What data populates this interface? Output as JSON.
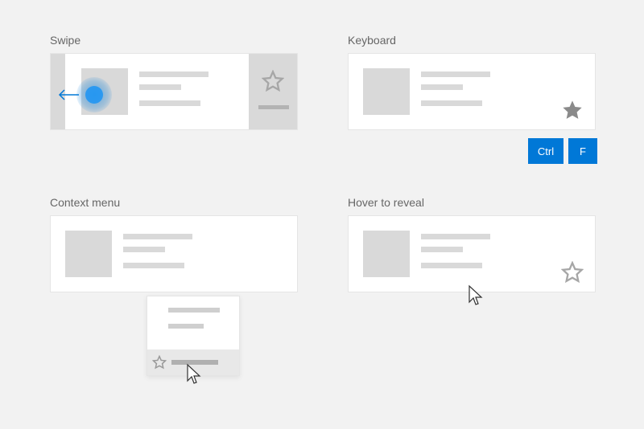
{
  "sections": {
    "swipe": {
      "label": "Swipe"
    },
    "keyboard": {
      "label": "Keyboard"
    },
    "context_menu": {
      "label": "Context menu"
    },
    "hover": {
      "label": "Hover to reveal"
    }
  },
  "keys": {
    "ctrl": "Ctrl",
    "f": "F"
  }
}
